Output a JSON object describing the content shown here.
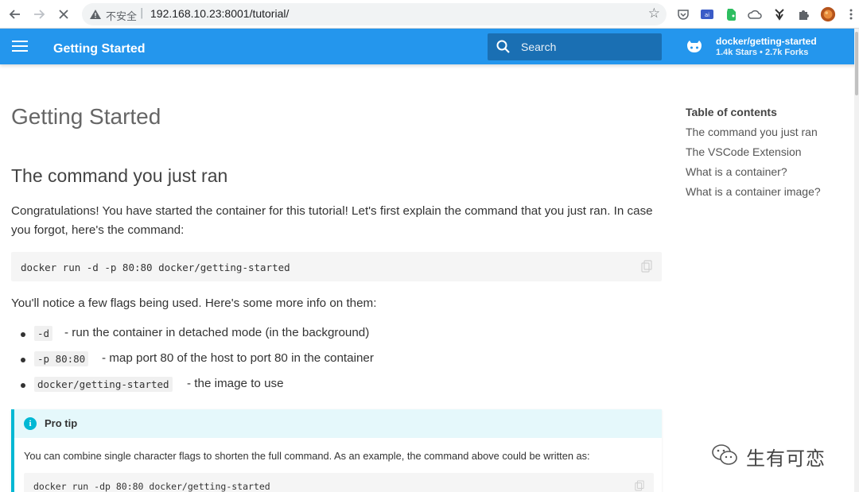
{
  "browser": {
    "insecure_label": "不安全",
    "separator": "|",
    "url": "192.168.10.23:8001/tutorial/"
  },
  "header": {
    "title": "Getting Started",
    "search_placeholder": "Search",
    "repo_name": "docker/getting-started",
    "repo_facts": "1.4k Stars • 2.7k Forks",
    "brand_color": "#2496ed"
  },
  "main": {
    "page_title": "Getting Started",
    "section_title": "The command you just ran",
    "intro": "Congratulations! You have started the container for this tutorial! Let's first explain the command that you just ran. In case you forgot, here's the command:",
    "command": "docker run -d -p 80:80 docker/getting-started",
    "flags_intro": "You'll notice a few flags being used. Here's some more info on them:",
    "bullets": [
      {
        "code": "-d",
        "text": "- run the container in detached mode (in the background)"
      },
      {
        "code": "-p 80:80",
        "text": "- map port 80 of the host to port 80 in the container"
      },
      {
        "code": "docker/getting-started",
        "text": "- the image to use"
      }
    ],
    "tip": {
      "title": "Pro tip",
      "body": "You can combine single character flags to shorten the full command. As an example, the command above could be written as:",
      "command": "docker run -dp 80:80 docker/getting-started"
    }
  },
  "toc": {
    "title": "Table of contents",
    "items": [
      "The command you just ran",
      "The VSCode Extension",
      "What is a container?",
      "What is a container image?"
    ]
  },
  "watermark": {
    "text": "生有可恋"
  }
}
